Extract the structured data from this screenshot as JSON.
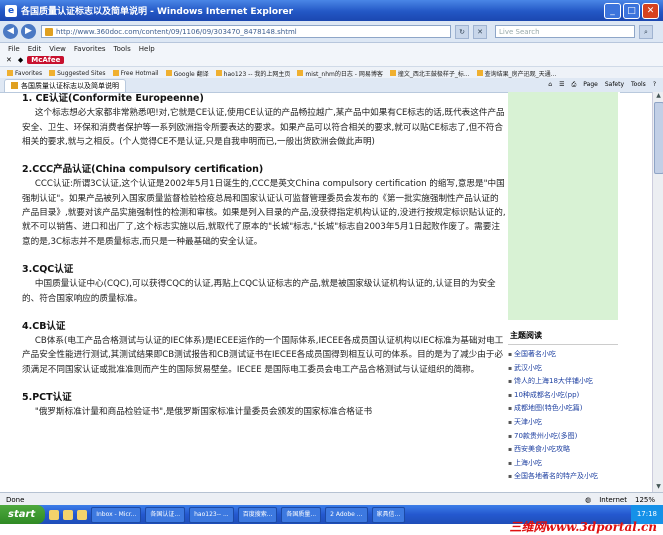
{
  "window": {
    "title": "各国质量认证标志以及简单说明 - Windows Internet Explorer"
  },
  "address": {
    "url": "http://www.360doc.com/content/09/1106/09/303470_8478148.shtml",
    "search_placeholder": "Live Search"
  },
  "menu": [
    "File",
    "Edit",
    "View",
    "Favorites",
    "Tools",
    "Help"
  ],
  "toolbar2": {
    "mcafee": "McAfee"
  },
  "favbar": {
    "favorites": "Favorites",
    "items": [
      "Suggested Sites",
      "Free Hotmail",
      "Google 翻译",
      "hao123 -- 我的上网主页",
      "mist_nhm的日志 - 网易博客",
      "撞文_西北王鼓极样子_标...",
      "查询结果_房产迅观_天通..."
    ]
  },
  "tab": {
    "label": "各国质量认证标志以及简单说明"
  },
  "tools": [
    "Page",
    "Safety",
    "Tools"
  ],
  "content": {
    "s1_title": "1. CE认证(Conformite Europeenne)",
    "s1_text": "这个标志想必大家都非常熟悉吧!对,它就是CE认证,使用CE认证的产品畅拉越广,某产品中如果有CE标志的话,既代表这件产品安全、卫生、环保和消费者保护等一系列欧洲指令所要表达的要求。如果产品可以符合相关的要求,就可以贴CE标志了,但不符合相关的要求,就与之相反。(个人觉得CE不是认证,只是自我申明而已,一般出货欧洲会做此声明)",
    "s2_title": "2.CCC产品认证(China compulsory certification)",
    "s2_text": "CCC认证:所谓3C认证,这个认证是2002年5月1日诞生的,CCC是英文China compulsory certification 的缩写,意思是\"中国强制认证\"。如果产品被列入国家质量监督检验检疫总局和国家认证认可监督管理委员会发布的《第一批实施强制性产品认证的产品目录》,就要对该产品实施强制性的检测和审核。如果是列入目录的产品,没获得指定机构认证的,没进行按规定标识贴认证的,就不可以销售、进口和出厂了,这个标志实施以后,就取代了原本的\"长城\"标志,\"长城\"标志自2003年5月1日起败作废了。需要注意的是,3C标志并不是质量标志,而只是一种最基础的安全认证。",
    "s3_title": "3.CQC认证",
    "s3_text": "中国质量认证中心(CQC),可以获得CQC的认证,再贴上CQC认证标志的产品,就是被国家级认证机构认证的,认证目的为安全的、符合国家响应的质量标准。",
    "s4_title": "4.CB认证",
    "s4_text": "CB体系(电工产品合格测试与认证的IEC体系)是IECEE运作的一个国际体系,IECEE各成员国认证机构以IEC标准为基础对电工产品安全性能进行测试,其测试结果即CB测试报告和CB测试证书在IECEE各成员国得到相互认可的体系。目的是为了减少由于必须满足不同国家认证或批准准则而产生的国际贸易壁垒。IECEE 是国际电工委员会电工产品合格测试与认证组织的简称。",
    "s5_title": "5.PCT认证",
    "s5_text": "\"俄罗斯标准计量和商品检验证书\",是俄罗斯国家标准计量委员会颁发的国家标准合格证书"
  },
  "sidebar": {
    "title": "主题阅读",
    "items": [
      "全国著名小吃",
      "武汉小吃",
      "馋人的上海18大伴铺小吃",
      "10种成都名小吃(pp)",
      "成都地图(特色小吃篇)",
      "天津小吃",
      "70款贵州小吃(多图)",
      "西安美食小吃攻略",
      "上海小吃",
      "全国各地著名的特产及小吃"
    ]
  },
  "status": {
    "left": "Done",
    "zone": "Internet",
    "zoom": "125%"
  },
  "taskbar": {
    "start": "start",
    "tasks": [
      "Inbox - Micr...",
      "各国认证...",
      "hao123-- ...",
      "百度搜索...",
      "各国质量...",
      "2 Adobe ...",
      "家具信..."
    ],
    "time": "17:18"
  },
  "watermark": "三维网www.3dportal.cn",
  "colors": {
    "titlebar": "#2357c5",
    "sidebar_green": "#d8f2d4",
    "link": "#1d3fa0",
    "watermark": "#e01010"
  }
}
